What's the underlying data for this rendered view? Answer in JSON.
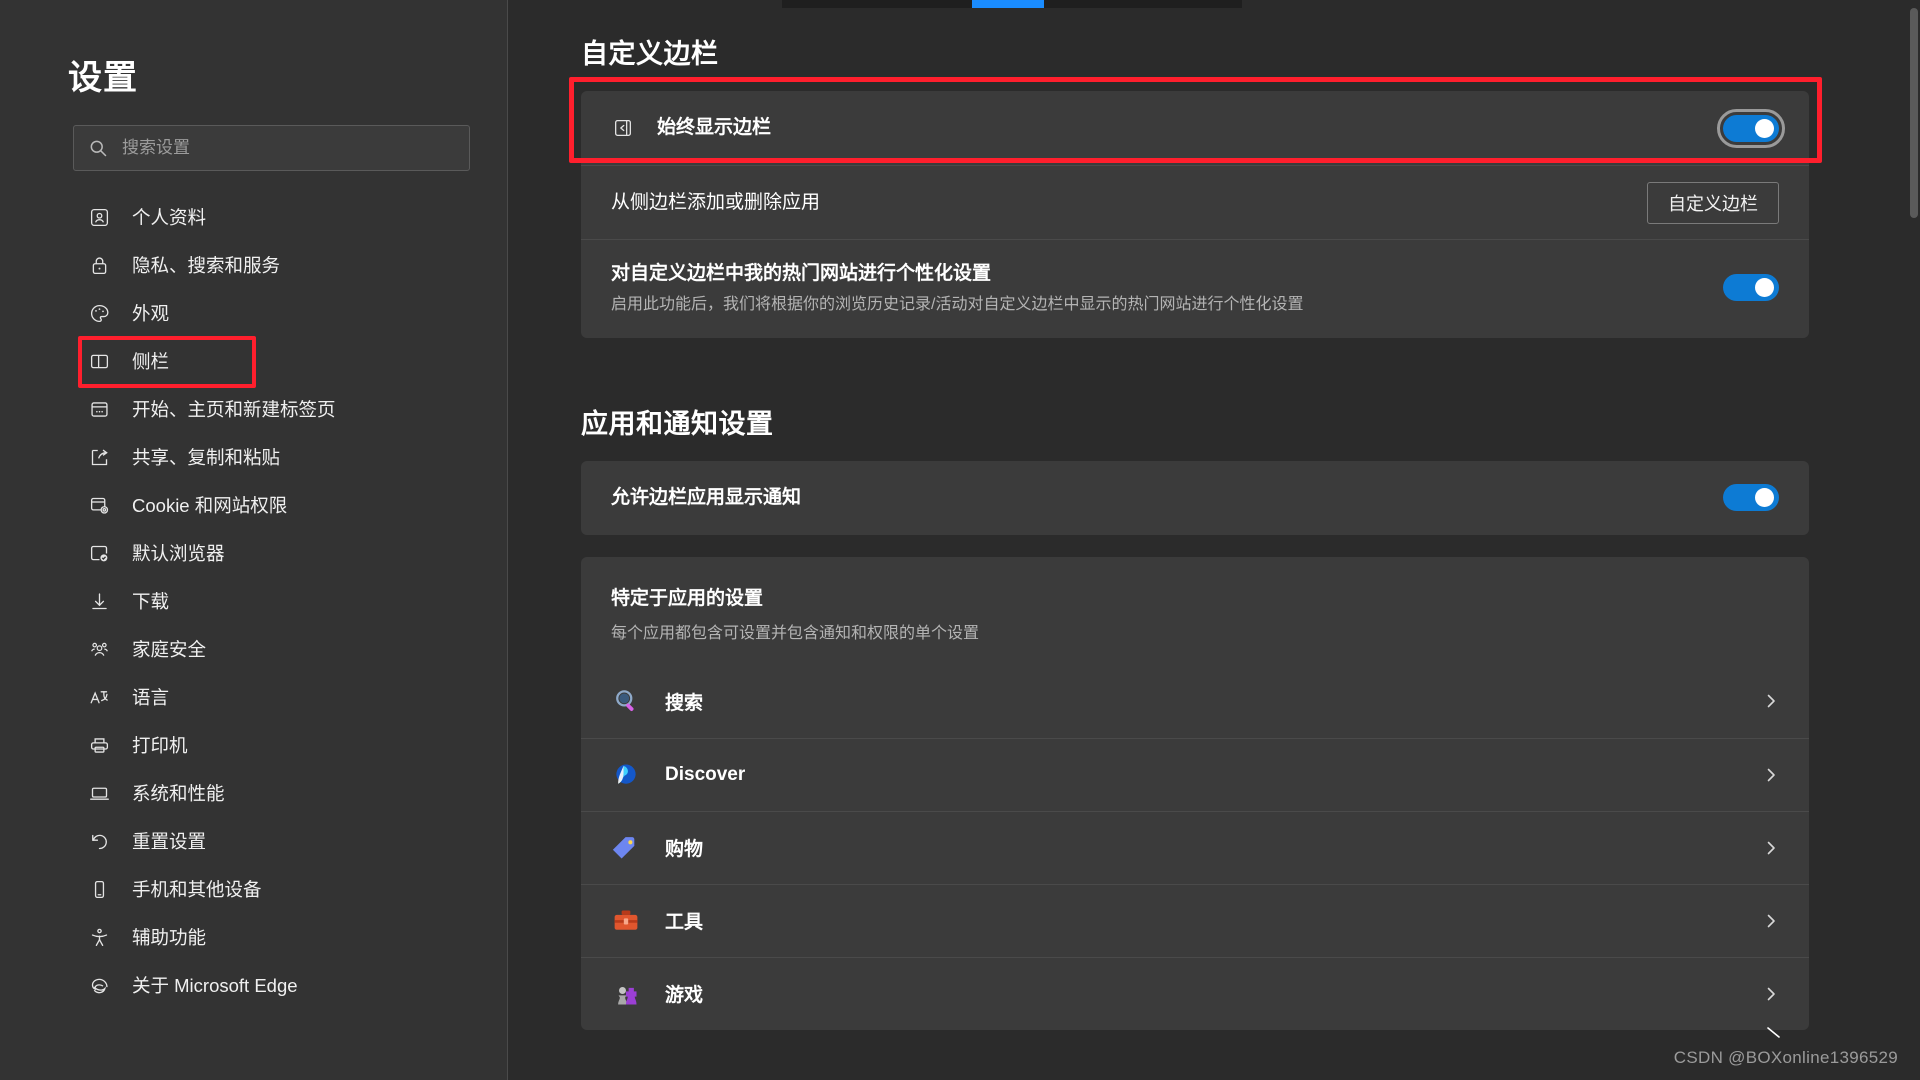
{
  "window": {
    "theme_bg": "#2b2b2b",
    "sidebar_bg": "#333333",
    "card_bg": "#3b3b3b",
    "accent_blue": "#0d7bd4",
    "annotation_red": "#ff1f2d"
  },
  "sidebar": {
    "title": "设置",
    "search": {
      "placeholder": "搜索设置",
      "value": ""
    },
    "items": [
      {
        "label": "个人资料",
        "icon": "profile-icon",
        "highlighted": false
      },
      {
        "label": "隐私、搜索和服务",
        "icon": "lock-icon",
        "highlighted": false
      },
      {
        "label": "外观",
        "icon": "palette-icon",
        "highlighted": false
      },
      {
        "label": "侧栏",
        "icon": "sidebar-icon",
        "highlighted": true
      },
      {
        "label": "开始、主页和新建标签页",
        "icon": "start-page-icon",
        "highlighted": false
      },
      {
        "label": "共享、复制和粘贴",
        "icon": "share-icon",
        "highlighted": false
      },
      {
        "label": "Cookie 和网站权限",
        "icon": "cookie-permissions-icon",
        "highlighted": false
      },
      {
        "label": "默认浏览器",
        "icon": "default-browser-icon",
        "highlighted": false
      },
      {
        "label": "下载",
        "icon": "download-icon",
        "highlighted": false
      },
      {
        "label": "家庭安全",
        "icon": "family-safety-icon",
        "highlighted": false
      },
      {
        "label": "语言",
        "icon": "language-icon",
        "highlighted": false
      },
      {
        "label": "打印机",
        "icon": "printer-icon",
        "highlighted": false
      },
      {
        "label": "系统和性能",
        "icon": "system-performance-icon",
        "highlighted": false
      },
      {
        "label": "重置设置",
        "icon": "reset-icon",
        "highlighted": false
      },
      {
        "label": "手机和其他设备",
        "icon": "phone-icon",
        "highlighted": false
      },
      {
        "label": "辅助功能",
        "icon": "accessibility-icon",
        "highlighted": false
      },
      {
        "label": "关于 Microsoft Edge",
        "icon": "edge-logo-icon",
        "highlighted": false
      }
    ]
  },
  "main": {
    "section_customize": {
      "title": "自定义边栏",
      "rows": [
        {
          "label": "始终显示边栏",
          "icon": "show-sidebar-icon",
          "control": "toggle",
          "toggle_on": true,
          "focused": true,
          "annotated": true
        },
        {
          "label": "从侧边栏添加或删除应用",
          "control": "button",
          "button_label": "自定义边栏"
        },
        {
          "label": "对自定义边栏中我的热门网站进行个性化设置",
          "sub": "启用此功能后，我们将根据你的浏览历史记录/活动对自定义边栏中显示的热门网站进行个性化设置",
          "control": "toggle",
          "toggle_on": true,
          "focused": false
        }
      ]
    },
    "section_apps": {
      "title": "应用和通知设置",
      "notification_row": {
        "label": "允许边栏应用显示通知",
        "control": "toggle",
        "toggle_on": true
      },
      "app_specific": {
        "title": "特定于应用的设置",
        "sub": "每个应用都包含可设置并包含通知和权限的单个设置"
      },
      "apps": [
        {
          "name": "搜索",
          "icon": "magnifier-app-icon",
          "chevron": "chevron-right-icon"
        },
        {
          "name": "Discover",
          "icon": "discover-app-icon",
          "chevron": "chevron-right-icon"
        },
        {
          "name": "购物",
          "icon": "shopping-tag-app-icon",
          "chevron": "chevron-right-icon"
        },
        {
          "name": "工具",
          "icon": "toolbox-app-icon",
          "chevron": "chevron-right-icon"
        },
        {
          "name": "游戏",
          "icon": "games-app-icon",
          "chevron": "chevron-right-icon"
        }
      ]
    }
  },
  "watermark": "CSDN @BOXonline1396529"
}
